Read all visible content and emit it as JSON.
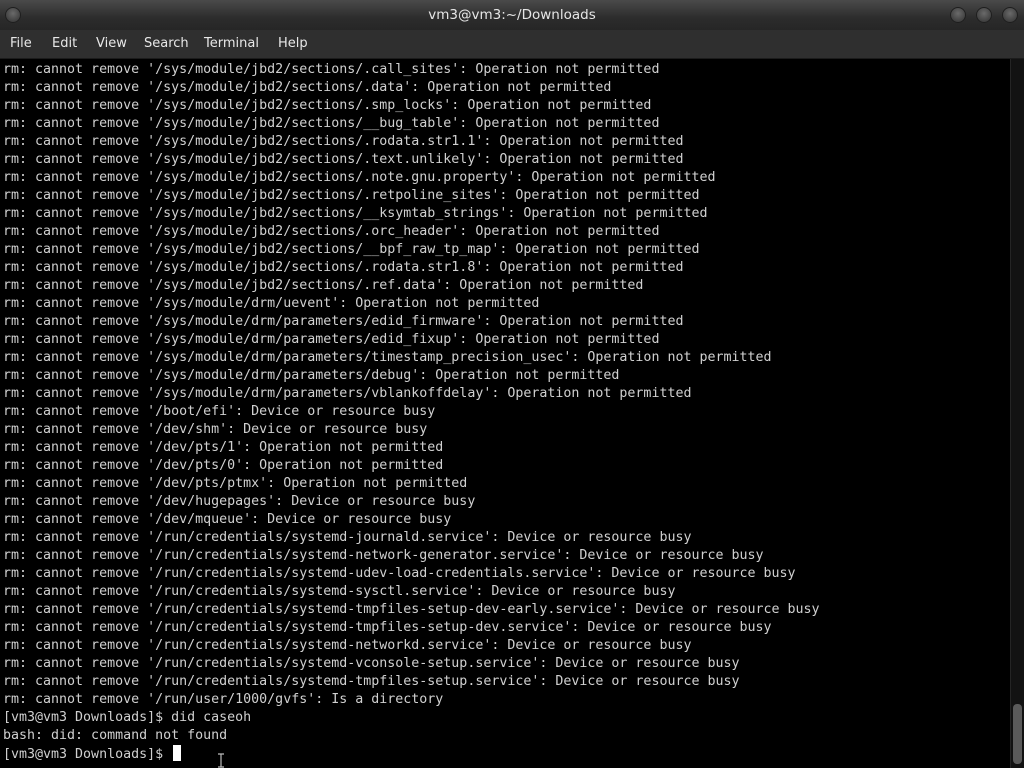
{
  "window": {
    "title": "vm3@vm3:~/Downloads"
  },
  "menu": [
    "File",
    "Edit",
    "View",
    "Search",
    "Terminal",
    "Help"
  ],
  "terminal": {
    "lines": [
      "rm: cannot remove '/sys/module/jbd2/sections/.call_sites': Operation not permitted",
      "rm: cannot remove '/sys/module/jbd2/sections/.data': Operation not permitted",
      "rm: cannot remove '/sys/module/jbd2/sections/.smp_locks': Operation not permitted",
      "rm: cannot remove '/sys/module/jbd2/sections/__bug_table': Operation not permitted",
      "rm: cannot remove '/sys/module/jbd2/sections/.rodata.str1.1': Operation not permitted",
      "rm: cannot remove '/sys/module/jbd2/sections/.text.unlikely': Operation not permitted",
      "rm: cannot remove '/sys/module/jbd2/sections/.note.gnu.property': Operation not permitted",
      "rm: cannot remove '/sys/module/jbd2/sections/.retpoline_sites': Operation not permitted",
      "rm: cannot remove '/sys/module/jbd2/sections/__ksymtab_strings': Operation not permitted",
      "rm: cannot remove '/sys/module/jbd2/sections/.orc_header': Operation not permitted",
      "rm: cannot remove '/sys/module/jbd2/sections/__bpf_raw_tp_map': Operation not permitted",
      "rm: cannot remove '/sys/module/jbd2/sections/.rodata.str1.8': Operation not permitted",
      "rm: cannot remove '/sys/module/jbd2/sections/.ref.data': Operation not permitted",
      "rm: cannot remove '/sys/module/drm/uevent': Operation not permitted",
      "rm: cannot remove '/sys/module/drm/parameters/edid_firmware': Operation not permitted",
      "rm: cannot remove '/sys/module/drm/parameters/edid_fixup': Operation not permitted",
      "rm: cannot remove '/sys/module/drm/parameters/timestamp_precision_usec': Operation not permitted",
      "rm: cannot remove '/sys/module/drm/parameters/debug': Operation not permitted",
      "rm: cannot remove '/sys/module/drm/parameters/vblankoffdelay': Operation not permitted",
      "rm: cannot remove '/boot/efi': Device or resource busy",
      "rm: cannot remove '/dev/shm': Device or resource busy",
      "rm: cannot remove '/dev/pts/1': Operation not permitted",
      "rm: cannot remove '/dev/pts/0': Operation not permitted",
      "rm: cannot remove '/dev/pts/ptmx': Operation not permitted",
      "rm: cannot remove '/dev/hugepages': Device or resource busy",
      "rm: cannot remove '/dev/mqueue': Device or resource busy",
      "rm: cannot remove '/run/credentials/systemd-journald.service': Device or resource busy",
      "rm: cannot remove '/run/credentials/systemd-network-generator.service': Device or resource busy",
      "rm: cannot remove '/run/credentials/systemd-udev-load-credentials.service': Device or resource busy",
      "rm: cannot remove '/run/credentials/systemd-sysctl.service': Device or resource busy",
      "rm: cannot remove '/run/credentials/systemd-tmpfiles-setup-dev-early.service': Device or resource busy",
      "rm: cannot remove '/run/credentials/systemd-tmpfiles-setup-dev.service': Device or resource busy",
      "rm: cannot remove '/run/credentials/systemd-networkd.service': Device or resource busy",
      "rm: cannot remove '/run/credentials/systemd-vconsole-setup.service': Device or resource busy",
      "rm: cannot remove '/run/credentials/systemd-tmpfiles-setup.service': Device or resource busy",
      "rm: cannot remove '/run/user/1000/gvfs': Is a directory",
      "[vm3@vm3 Downloads]$ did caseoh",
      "bash: did: command not found"
    ],
    "prompt": "[vm3@vm3 Downloads]$ "
  }
}
